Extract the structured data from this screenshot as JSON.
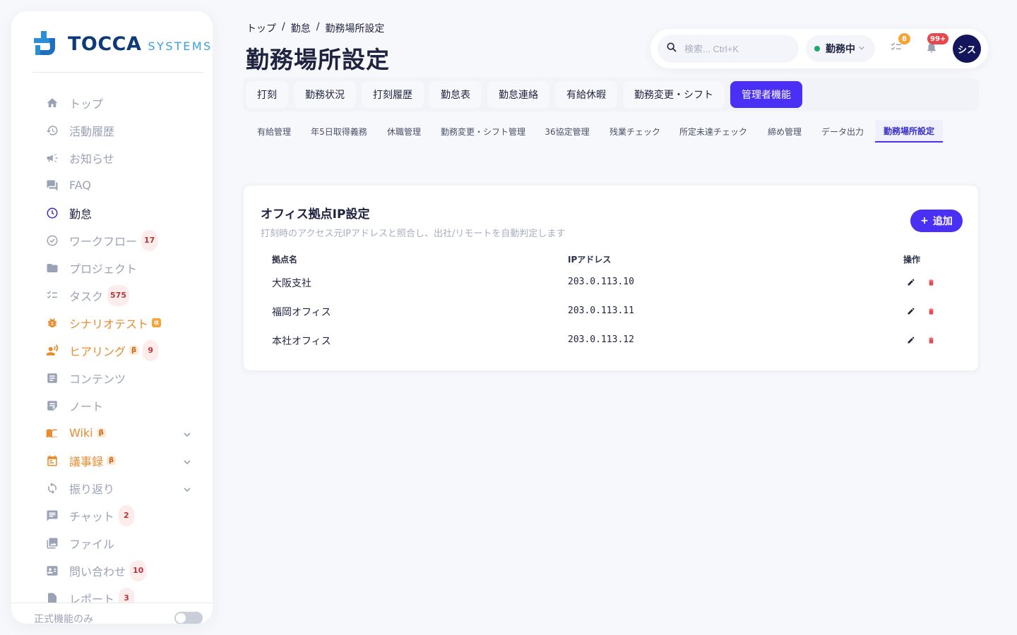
{
  "brand": {
    "name": "TOCCA",
    "suffix": "SYSTEMS"
  },
  "sidebar": {
    "items": [
      {
        "label": "トップ",
        "icon": "home-icon"
      },
      {
        "label": "活動履歴",
        "icon": "history-icon"
      },
      {
        "label": "お知らせ",
        "icon": "megaphone-icon"
      },
      {
        "label": "FAQ",
        "icon": "forum-icon"
      },
      {
        "label": "勤怠",
        "icon": "clock-icon"
      },
      {
        "label": "ワークフロー",
        "icon": "check-circle-icon",
        "badge": "17"
      },
      {
        "label": "プロジェクト",
        "icon": "folder-icon"
      },
      {
        "label": "タスク",
        "icon": "checklist-icon",
        "badge": "575"
      },
      {
        "label": "シナリオテスト",
        "icon": "bug-icon",
        "tag": "α"
      },
      {
        "label": "ヒアリング",
        "icon": "voice-icon",
        "tag": "β",
        "badge": "9"
      },
      {
        "label": "コンテンツ",
        "icon": "article-icon"
      },
      {
        "label": "ノート",
        "icon": "note-icon"
      },
      {
        "label": "Wiki",
        "icon": "book-icon",
        "tag": "β"
      },
      {
        "label": "議事録",
        "icon": "calendar-icon",
        "tag": "β"
      },
      {
        "label": "振り返り",
        "icon": "refresh-icon"
      },
      {
        "label": "チャット",
        "icon": "chat-icon",
        "badge": "2"
      },
      {
        "label": "ファイル",
        "icon": "image-icon"
      },
      {
        "label": "問い合わせ",
        "icon": "contact-card-icon",
        "badge": "10"
      },
      {
        "label": "レポート",
        "icon": "report-icon",
        "badge": "3"
      }
    ],
    "footer_label": "正式機能のみ"
  },
  "breadcrumb": [
    "トップ",
    "勤怠",
    "勤務場所設定"
  ],
  "page_title": "勤務場所設定",
  "topbar": {
    "search_placeholder": "検索... Ctrl+K",
    "status_label": "勤務中",
    "tasks_badge": "8",
    "notifications_badge": "99+",
    "avatar_label": "シス"
  },
  "tabs": [
    "打刻",
    "勤務状況",
    "打刻履歴",
    "勤怠表",
    "勤怠連絡",
    "有給休暇",
    "勤務変更・シフト",
    "管理者機能"
  ],
  "subtabs": [
    "有給管理",
    "年5日取得義務",
    "休職管理",
    "勤務変更・シフト管理",
    "36協定管理",
    "残業チェック",
    "所定未達チェック",
    "締め管理",
    "データ出力",
    "勤務場所設定"
  ],
  "card": {
    "title": "オフィス拠点IP設定",
    "subtitle": "打刻時のアクセス元IPアドレスと照合し、出社/リモートを自動判定します",
    "add_label": "追加",
    "columns": [
      "拠点名",
      "IPアドレス",
      "操作"
    ],
    "rows": [
      {
        "name": "大阪支社",
        "ip": "203.0.113.10"
      },
      {
        "name": "福岡オフィス",
        "ip": "203.0.113.11"
      },
      {
        "name": "本社オフィス",
        "ip": "203.0.113.12"
      }
    ]
  },
  "colors": {
    "accent": "#4a2ff5",
    "orange": "#e98b2f",
    "danger": "#e5484d"
  }
}
